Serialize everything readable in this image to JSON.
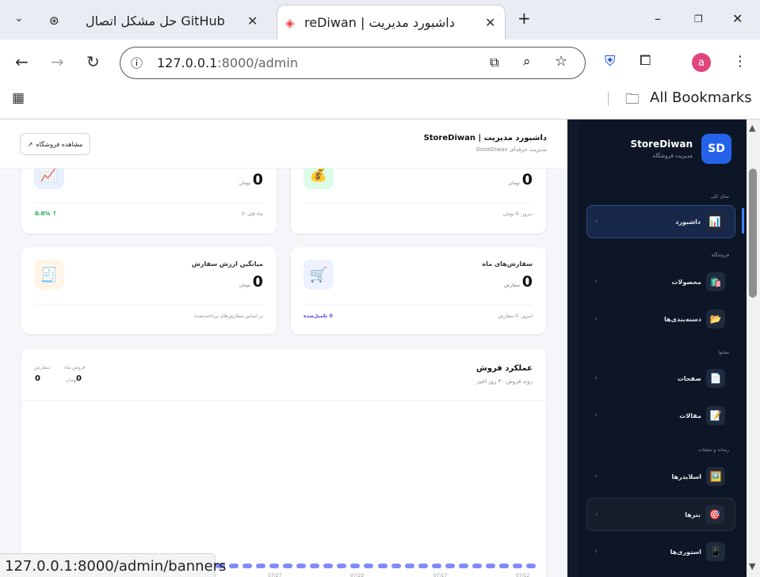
{
  "browser": {
    "tabs": [
      {
        "title": "حل مشکل اتصال GitHub"
      },
      {
        "title": "داشبورد مدیریت | StoreDiwan"
      }
    ],
    "tab_visible_text": "reDiwan | داشبورد مدیریت",
    "url_host": "127.0.0.1",
    "url_path": ":8000/admin",
    "bookmarks_label": "All Bookmarks",
    "profile_initial": "a",
    "status_url": "127.0.0.1:8000/admin/banners"
  },
  "header": {
    "title": "داشبورد مدیریت | StoreDiwan",
    "subtitle": "مدیریت حرفه‌ای StoreDiwan",
    "view_store": "مشاهده فروشگاه",
    "view_store_icon": "↗"
  },
  "cards": {
    "revenue_today": {
      "value": "0",
      "unit": "تومان",
      "foot": "دیروز: 0 تومان"
    },
    "revenue_month": {
      "value": "0",
      "unit": "تومان",
      "foot": "ماه قبل: 0",
      "growth": "↑ 0.0%"
    },
    "orders_month": {
      "title": "سفارش‌های ماه",
      "value": "0",
      "unit": "سفارش",
      "foot": "امروز: 0 سفارش",
      "foot_link": "0 تکمیل‌شده"
    },
    "avg_order": {
      "title": "میانگین ارزش سفارش",
      "value": "0",
      "unit": "تومان",
      "foot": "بر اساس سفارش‌های پرداخت‌شده"
    }
  },
  "performance": {
    "title": "عملکرد فروش",
    "subtitle": "روند فروش ۳۰ روز اخیر",
    "month_sales_label": "فروش ماه",
    "month_sales_value": "0",
    "month_sales_unit": "تومان",
    "orders_label": "سفارش",
    "orders_value": "0"
  },
  "chart_data": {
    "type": "line",
    "x": [
      "07/12",
      "07/17",
      "07/22",
      "07/27"
    ],
    "series": [
      {
        "values": [
          0,
          0,
          0,
          0
        ]
      }
    ]
  },
  "sidebar": {
    "brand": "StoreDiwan",
    "brand_sub": "مدیریت فروشگاه",
    "logo": "SD",
    "sections": {
      "overview": "نمای کلی",
      "store": "فروشگاه",
      "content": "محتوا",
      "media": "رسانه و تبلیغات"
    },
    "items": [
      {
        "label": "داشبورد",
        "icon": "📊"
      },
      {
        "label": "محصولات",
        "icon": "🛍️"
      },
      {
        "label": "دسته‌بندی‌ها",
        "icon": "📂"
      },
      {
        "label": "صفحات",
        "icon": "📄"
      },
      {
        "label": "مقالات",
        "icon": "📝"
      },
      {
        "label": "اسلایدرها",
        "icon": "🖼️"
      },
      {
        "label": "بنرها",
        "icon": "🎯"
      },
      {
        "label": "استوری‌ها",
        "icon": "📱"
      }
    ]
  },
  "colors": {
    "accent": "#2563eb",
    "sidebar_bg": "#0d1626",
    "chart_line": "#818cf8",
    "growth": "#16a34a"
  }
}
